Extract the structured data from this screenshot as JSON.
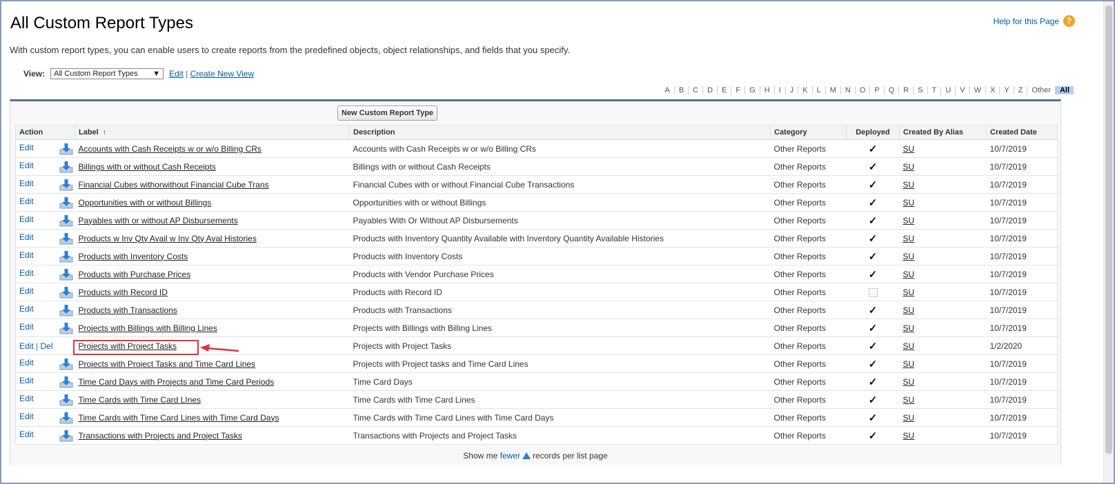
{
  "page": {
    "title": "All Custom Report Types",
    "help_link": "Help for this Page",
    "intro": "With custom report types, you can enable users to create reports from the predefined objects, object relationships, and fields that you specify."
  },
  "view": {
    "label": "View:",
    "selected": "All Custom Report Types",
    "edit": "Edit",
    "sep": "|",
    "create": "Create New View"
  },
  "alpha": [
    "A",
    "B",
    "C",
    "D",
    "E",
    "F",
    "G",
    "H",
    "I",
    "J",
    "K",
    "L",
    "M",
    "N",
    "O",
    "P",
    "Q",
    "R",
    "S",
    "T",
    "U",
    "V",
    "W",
    "X",
    "Y",
    "Z",
    "Other"
  ],
  "alpha_active": "All",
  "new_button": "New Custom Report Type",
  "columns": {
    "action": "Action",
    "label": "Label",
    "sort_indicator": "↑",
    "description": "Description",
    "category": "Category",
    "deployed": "Deployed",
    "alias": "Created By Alias",
    "date": "Created Date"
  },
  "rows": [
    {
      "actions": [
        "Edit"
      ],
      "label": "Accounts with Cash Receipts w or w/o Billing CRs",
      "description": "Accounts with Cash Receipts w or w/o Billing CRs",
      "category": "Other Reports",
      "deployed": true,
      "alias": "SU",
      "date": "10/7/2019",
      "download": true
    },
    {
      "actions": [
        "Edit"
      ],
      "label": "Billings with or without Cash Receipts",
      "description": "Billings with or without Cash Receipts",
      "category": "Other Reports",
      "deployed": true,
      "alias": "SU",
      "date": "10/7/2019",
      "download": true
    },
    {
      "actions": [
        "Edit"
      ],
      "label": "Financial Cubes withorwithout Financial Cube Trans",
      "description": "Financial Cubes with or without Financial Cube Transactions",
      "category": "Other Reports",
      "deployed": true,
      "alias": "SU",
      "date": "10/7/2019",
      "download": true
    },
    {
      "actions": [
        "Edit"
      ],
      "label": "Opportunities with or without Billings",
      "description": "Opportunities with or without Billings",
      "category": "Other Reports",
      "deployed": true,
      "alias": "SU",
      "date": "10/7/2019",
      "download": true
    },
    {
      "actions": [
        "Edit"
      ],
      "label": "Payables with or without AP Disbursements",
      "description": "Payables With Or Without AP Disbursements",
      "category": "Other Reports",
      "deployed": true,
      "alias": "SU",
      "date": "10/7/2019",
      "download": true
    },
    {
      "actions": [
        "Edit"
      ],
      "label": "Products w Inv Qty Avail w Inv Qty Aval Histories",
      "description": "Products with Inventory Quantity Available with Inventory Quantity Available Histories",
      "category": "Other Reports",
      "deployed": true,
      "alias": "SU",
      "date": "10/7/2019",
      "download": true
    },
    {
      "actions": [
        "Edit"
      ],
      "label": "Products with Inventory Costs",
      "description": "Products with Inventory Costs",
      "category": "Other Reports",
      "deployed": true,
      "alias": "SU",
      "date": "10/7/2019",
      "download": true
    },
    {
      "actions": [
        "Edit"
      ],
      "label": "Products with Purchase Prices",
      "description": "Products with Vendor Purchase Prices",
      "category": "Other Reports",
      "deployed": true,
      "alias": "SU",
      "date": "10/7/2019",
      "download": true
    },
    {
      "actions": [
        "Edit"
      ],
      "label": "Products with Record ID",
      "description": "Products with Record ID",
      "category": "Other Reports",
      "deployed": false,
      "alias": "SU",
      "date": "10/7/2019",
      "download": true
    },
    {
      "actions": [
        "Edit"
      ],
      "label": "Products with Transactions",
      "description": "Products with Transactions",
      "category": "Other Reports",
      "deployed": true,
      "alias": "SU",
      "date": "10/7/2019",
      "download": true
    },
    {
      "actions": [
        "Edit"
      ],
      "label": "Projects with Billings with Billing Lines",
      "description": "Projects with Billings with Billing Lines",
      "category": "Other Reports",
      "deployed": true,
      "alias": "SU",
      "date": "10/7/2019",
      "download": true
    },
    {
      "actions": [
        "Edit",
        "Del"
      ],
      "label": "Projects with Project Tasks",
      "description": "Projects with Project Tasks",
      "category": "Other Reports",
      "deployed": true,
      "alias": "SU",
      "date": "1/2/2020",
      "download": false
    },
    {
      "actions": [
        "Edit"
      ],
      "label": "Projects with Project Tasks and Time Card Lines",
      "description": "Projects with Project tasks and Time Card Lines",
      "category": "Other Reports",
      "deployed": true,
      "alias": "SU",
      "date": "10/7/2019",
      "download": true
    },
    {
      "actions": [
        "Edit"
      ],
      "label": "Time Card Days with Projects and Time Card Periods",
      "description": "Time Card Days",
      "category": "Other Reports",
      "deployed": true,
      "alias": "SU",
      "date": "10/7/2019",
      "download": true
    },
    {
      "actions": [
        "Edit"
      ],
      "label": "Time Cards with Time Card LInes",
      "description": "Time Cards with Time Card Lines",
      "category": "Other Reports",
      "deployed": true,
      "alias": "SU",
      "date": "10/7/2019",
      "download": true
    },
    {
      "actions": [
        "Edit"
      ],
      "label": "Time Cards with Time Card Lines with Time Card Days",
      "description": "Time Cards with Time Card Lines with Time Card Days",
      "category": "Other Reports",
      "deployed": true,
      "alias": "SU",
      "date": "10/7/2019",
      "download": true
    },
    {
      "actions": [
        "Edit"
      ],
      "label": "Transactions with Projects and Project Tasks",
      "description": "Transactions with Projects and Project Tasks",
      "category": "Other Reports",
      "deployed": true,
      "alias": "SU",
      "date": "10/7/2019",
      "download": true
    }
  ],
  "footer": {
    "prefix": "Show me",
    "fewer": "fewer",
    "suffix": "records per list page"
  },
  "colors": {
    "link": "#015ba7",
    "header_border": "#5a6e8f",
    "highlight": "#e0323f",
    "help_icon": "#f0a42b"
  }
}
